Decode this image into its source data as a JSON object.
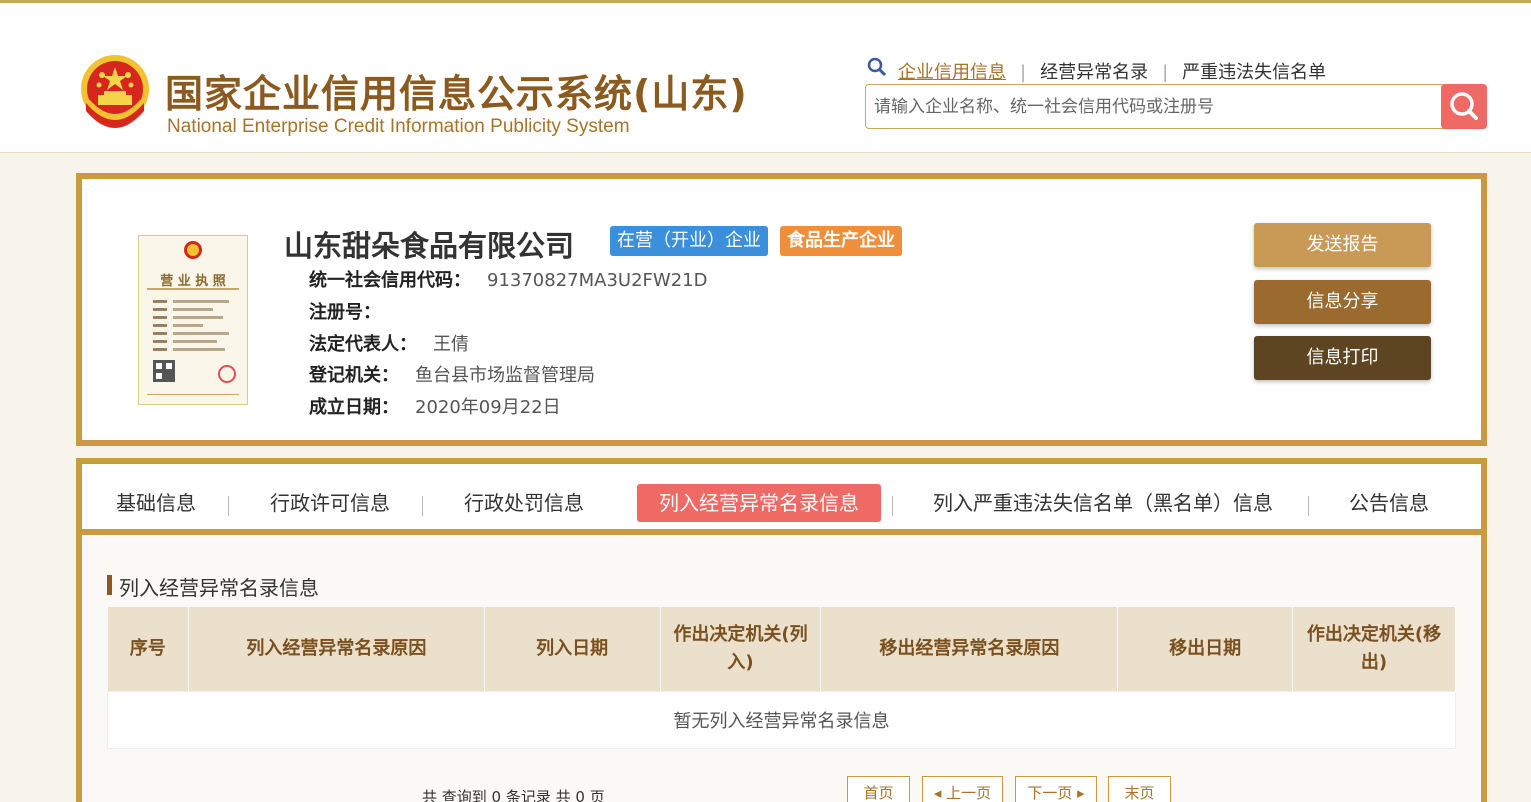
{
  "header": {
    "title_cn": "国家企业信用信息公示系统(山东)",
    "title_en": "National Enterprise Credit Information Publicity System",
    "nav": [
      "企业信用信息",
      "经营异常名录",
      "严重违法失信名单"
    ],
    "search_placeholder": "请输入企业名称、统一社会信用代码或注册号"
  },
  "company": {
    "name": "山东甜朵食品有限公司",
    "status_badge": "在营（开业）企业",
    "type_badge": "食品生产企业",
    "fields": [
      {
        "label": "统一社会信用代码：",
        "value": "91370827MA3U2FW21D"
      },
      {
        "label": "注册号：",
        "value": ""
      },
      {
        "label": "法定代表人：",
        "value": "王倩"
      },
      {
        "label": "登记机关：",
        "value": "鱼台县市场监督管理局"
      },
      {
        "label": "成立日期：",
        "value": "2020年09月22日"
      }
    ],
    "license_title": "营 业 执 照"
  },
  "actions": [
    "发送报告",
    "信息分享",
    "信息打印"
  ],
  "tabs": [
    "基础信息",
    "行政许可信息",
    "行政处罚信息",
    "列入经营异常名录信息",
    "列入严重违法失信名单（黑名单）信息",
    "公告信息"
  ],
  "section": {
    "title": "列入经营异常名录信息",
    "columns": [
      "序号",
      "列入经营异常名录原因",
      "列入日期",
      "作出决定机关(列入)",
      "移出经营异常名录原因",
      "移出日期",
      "作出决定机关(移出)"
    ],
    "empty_text": "暂无列入经营异常名录信息"
  },
  "pager": {
    "info": "共 查询到 0 条记录 共 0 页",
    "first": "首页",
    "prev": "上一页",
    "next": "下一页",
    "last": "末页"
  },
  "colors": {
    "gold": "#c99a3f",
    "red": "#ef6a65",
    "blue": "#3c8fdb",
    "orange": "#ef8f3c",
    "btn1": "#c99a56",
    "btn2": "#9a6a2e",
    "btn3": "#5c4520"
  }
}
